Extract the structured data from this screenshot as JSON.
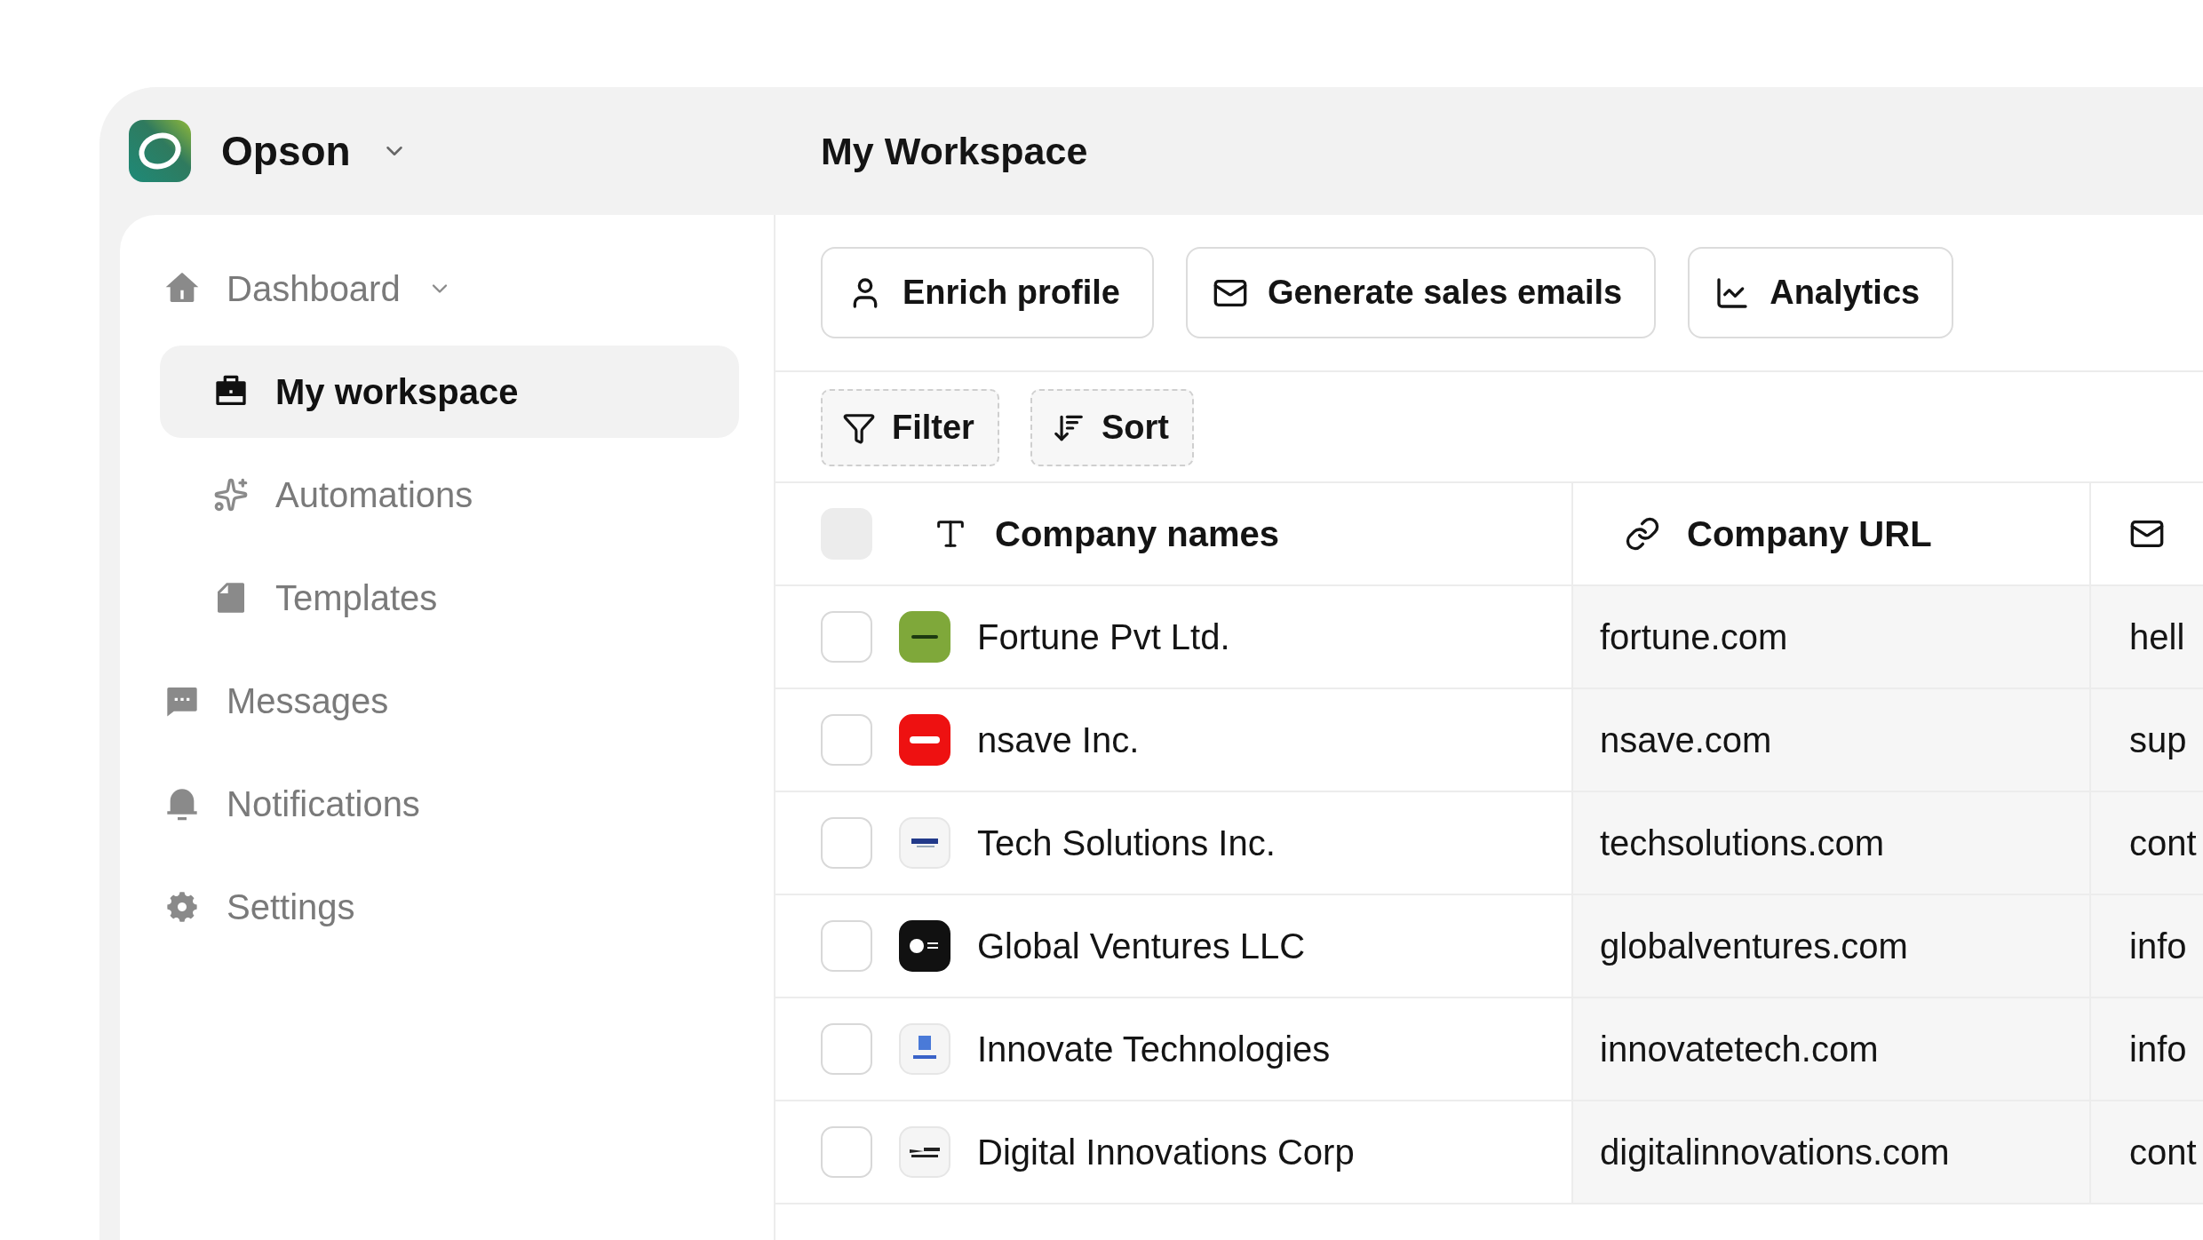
{
  "app": {
    "name": "Opson"
  },
  "page_title": "My Workspace",
  "sidebar": {
    "items": [
      {
        "label": "Dashboard",
        "expanded": true,
        "selected": false,
        "children": [
          {
            "label": "My workspace",
            "selected": true
          },
          {
            "label": "Automations",
            "selected": false
          },
          {
            "label": "Templates",
            "selected": false
          }
        ]
      },
      {
        "label": "Messages",
        "selected": false
      },
      {
        "label": "Notifications",
        "selected": false
      },
      {
        "label": "Settings",
        "selected": false
      }
    ]
  },
  "actions": [
    "Enrich profile",
    "Generate sales emails",
    "Analytics"
  ],
  "toolbar": [
    "Filter",
    "Sort"
  ],
  "table": {
    "select_all": {
      "checked": false
    },
    "columns": [
      "Company names",
      "Company URL"
    ],
    "rows": [
      {
        "checked": false,
        "color": "#7fa83a",
        "name": "Fortune Pvt Ltd.",
        "url": "fortune.com",
        "column_3": "hell"
      },
      {
        "checked": false,
        "color": "#ee1111",
        "name": "nsave Inc.",
        "url": "nsave.com",
        "column_3": "sup"
      },
      {
        "checked": false,
        "color": "#f5f5f5",
        "name": "Tech Solutions Inc.",
        "url": "techsolutions.com",
        "column_3": "cont"
      },
      {
        "checked": false,
        "color": "#111111",
        "name": "Global Ventures LLC",
        "url": "globalventures.com",
        "column_3": "info"
      },
      {
        "checked": false,
        "color": "#f5f5f5",
        "name": "Innovate Technologies",
        "url": "innovatetech.com",
        "column_3": "info"
      },
      {
        "checked": false,
        "color": "#f5f5f5",
        "name": "Digital Innovations Corp",
        "url": "digitalinnovations.com",
        "column_3": "cont"
      }
    ]
  }
}
